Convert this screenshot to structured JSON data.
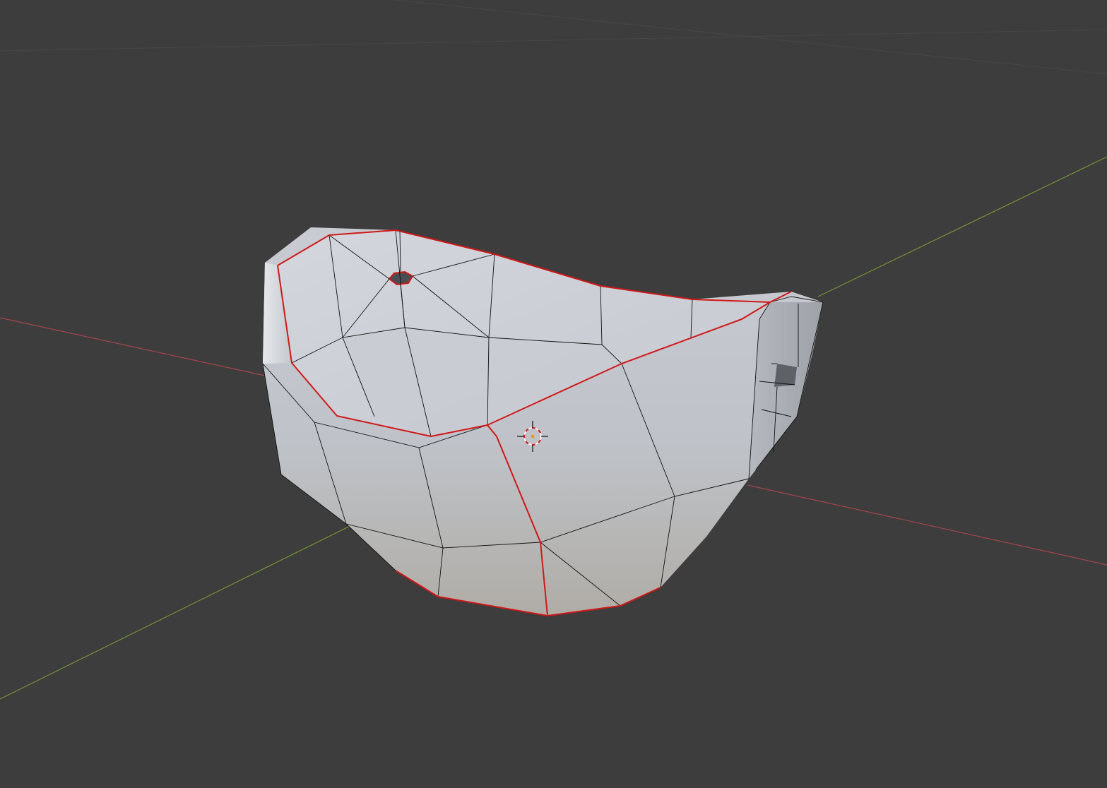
{
  "viewport": {
    "mode": "3d-viewport",
    "background_color": "#3d3d3d"
  },
  "axes": {
    "x_axis_color": "#b8474f",
    "y_axis_color": "#7a9b3a",
    "grid_color": "#474747"
  },
  "mesh": {
    "object": "cup",
    "shading": "solid",
    "base_color": "#c9ccd0",
    "wire_color": "#111111",
    "seam_color": "#d01818"
  },
  "cursor": {
    "icon": "3d-cursor-icon",
    "ring_color": "#d21a1a",
    "dash_color": "#ffffff"
  }
}
